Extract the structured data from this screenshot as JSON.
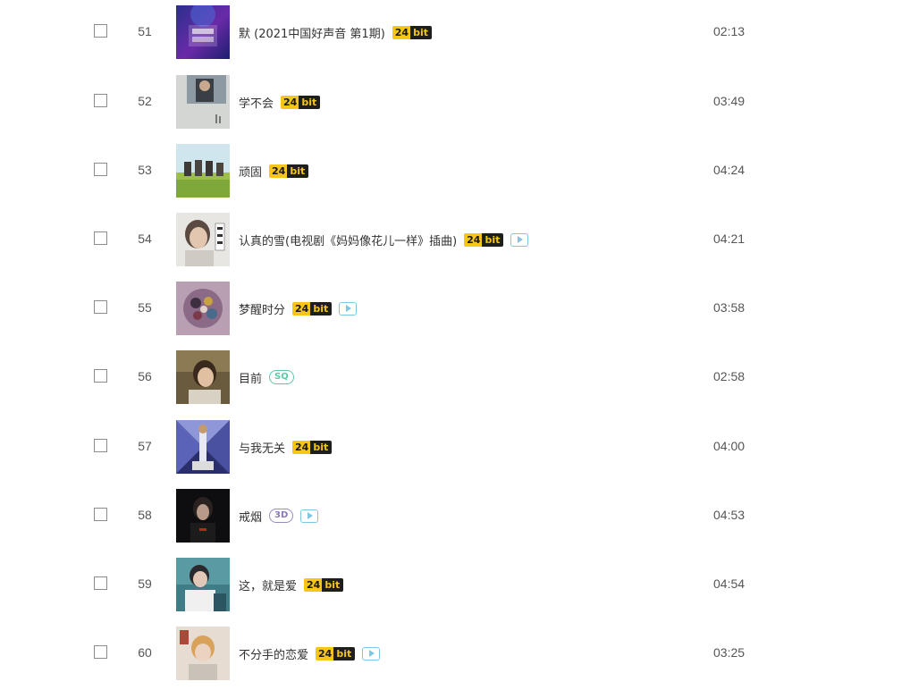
{
  "songs": [
    {
      "num": "51",
      "title": "默 (2021中国好声音 第1期)",
      "quality": "24bit",
      "mv": false,
      "duration": "02:13",
      "cover": "c51"
    },
    {
      "num": "52",
      "title": "学不会",
      "quality": "24bit",
      "mv": false,
      "duration": "03:49",
      "cover": "c52"
    },
    {
      "num": "53",
      "title": "顽固",
      "quality": "24bit",
      "mv": false,
      "duration": "04:24",
      "cover": "c53"
    },
    {
      "num": "54",
      "title": "认真的雪(电视剧《妈妈像花儿一样》插曲)",
      "quality": "24bit",
      "mv": true,
      "duration": "04:21",
      "cover": "c54"
    },
    {
      "num": "55",
      "title": "梦醒时分",
      "quality": "24bit",
      "mv": true,
      "duration": "03:58",
      "cover": "c55"
    },
    {
      "num": "56",
      "title": "目前",
      "quality": "SQ",
      "mv": false,
      "duration": "02:58",
      "cover": "c56"
    },
    {
      "num": "57",
      "title": "与我无关",
      "quality": "24bit",
      "mv": false,
      "duration": "04:00",
      "cover": "c57"
    },
    {
      "num": "58",
      "title": "戒烟",
      "quality": "3D",
      "mv": true,
      "duration": "04:53",
      "cover": "c58"
    },
    {
      "num": "59",
      "title": "这，就是爱",
      "quality": "24bit",
      "mv": false,
      "duration": "04:54",
      "cover": "c59"
    },
    {
      "num": "60",
      "title": "不分手的恋爱",
      "quality": "24bit",
      "mv": true,
      "duration": "03:25",
      "cover": "c60"
    }
  ],
  "badges": {
    "hires_part1": "24",
    "hires_part2": "bit",
    "sq": "SQ",
    "three_d": "3D"
  },
  "colors": {
    "hires_gold": "#f5c518",
    "hires_dark": "#1e1e1e",
    "sq_green": "#5cc9a7",
    "three_d_purple": "#8a7bb5",
    "mv_blue": "#7fc6e0"
  },
  "icons": {
    "row_select": "checkbox-icon",
    "mv": "play-mv-icon"
  }
}
